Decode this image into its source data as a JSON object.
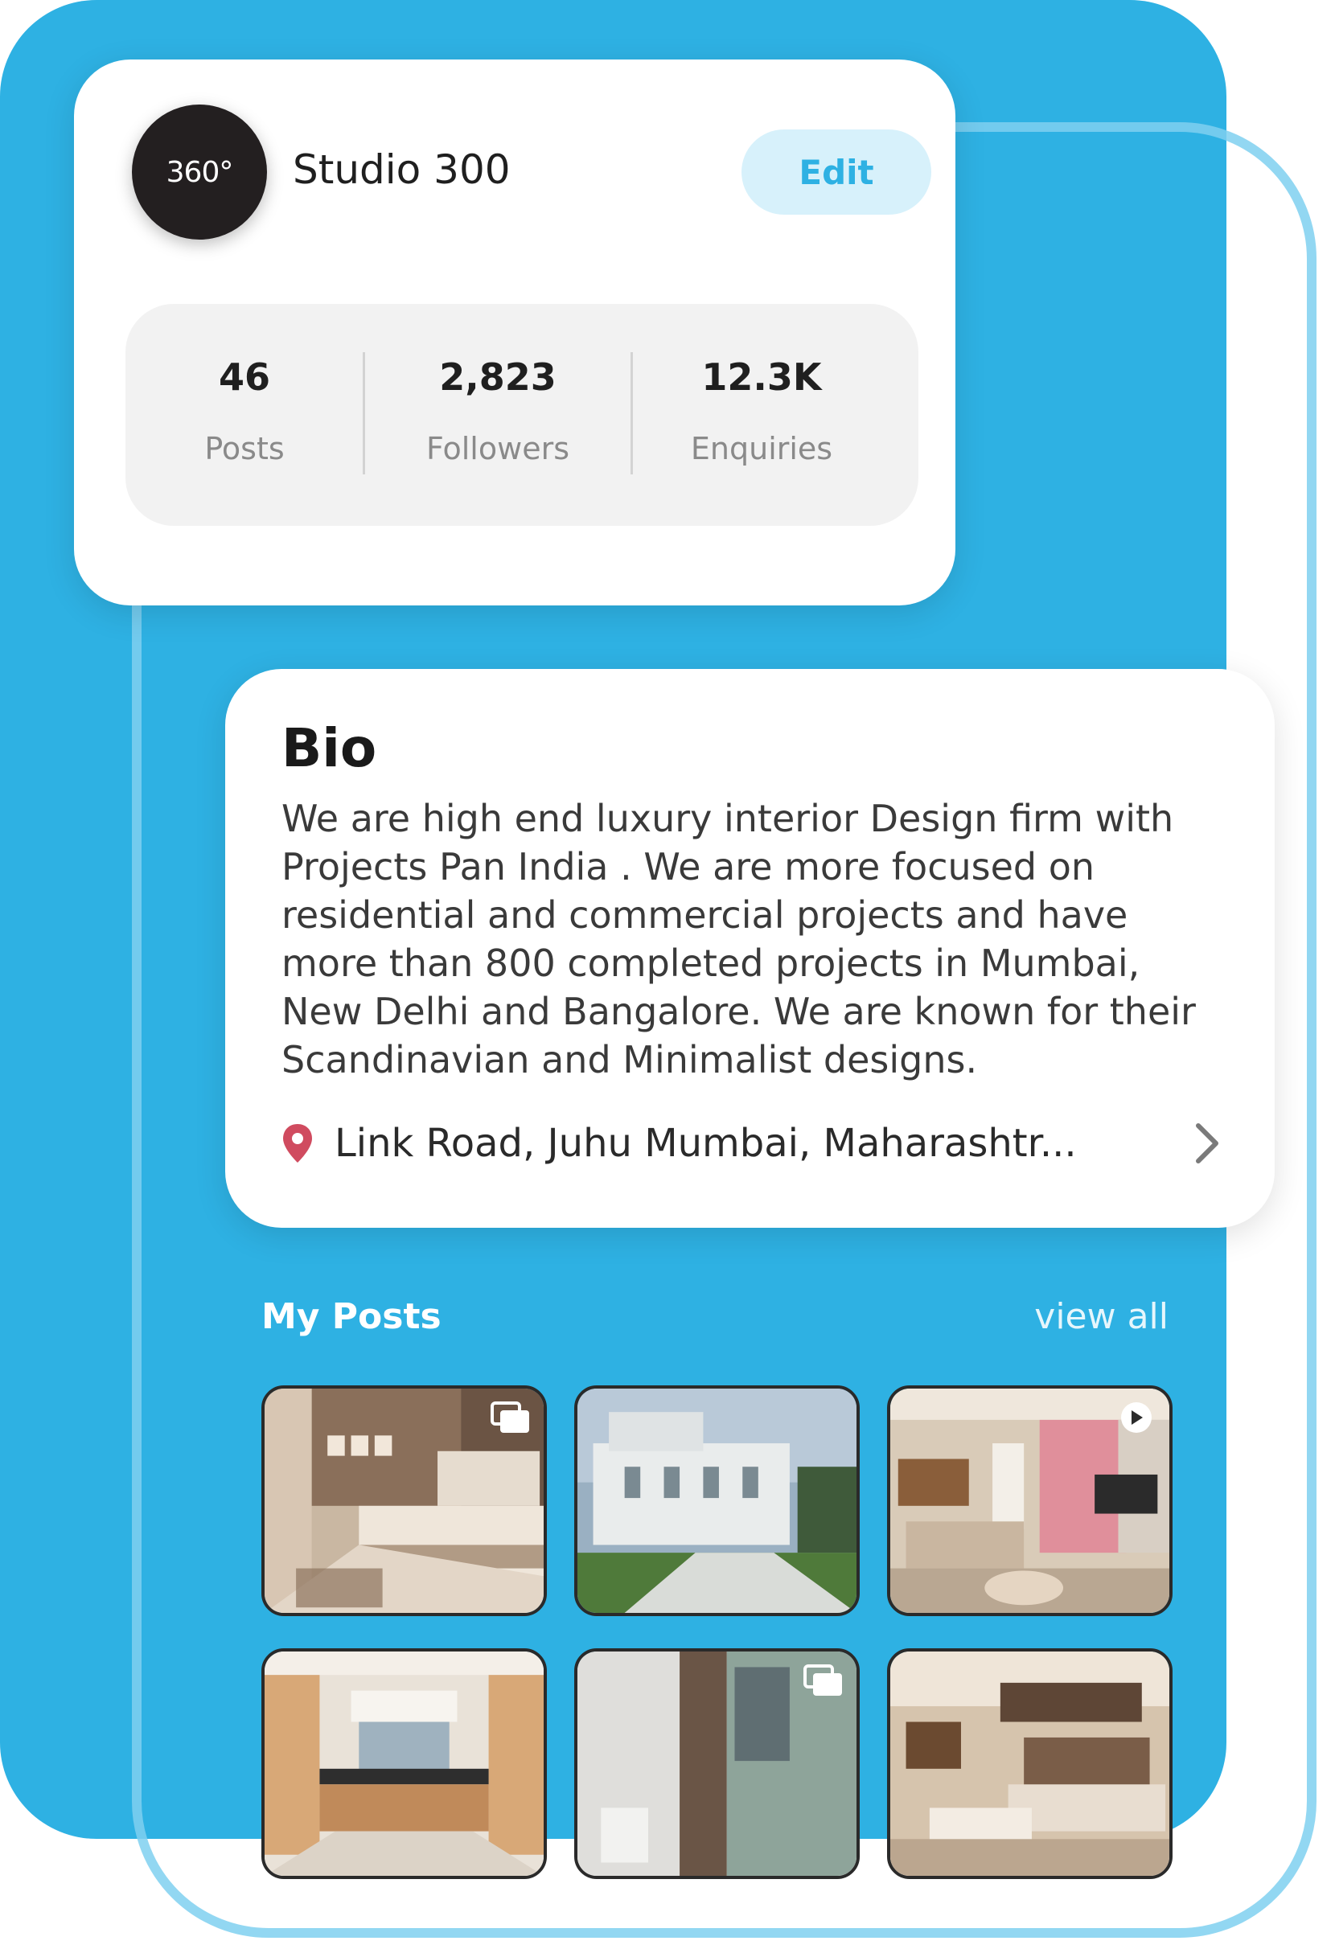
{
  "profile": {
    "avatar_text": "360°",
    "name": "Studio 300",
    "edit_label": "Edit",
    "stats": [
      {
        "value": "46",
        "label": "Posts"
      },
      {
        "value": "2,823",
        "label": "Followers"
      },
      {
        "value": "12.3K",
        "label": "Enquiries"
      }
    ]
  },
  "bio": {
    "title": "Bio",
    "text": "We are high end luxury interior Design firm with Projects Pan India . We are more focused on residential and commercial projects and have more than 800 completed projects in Mumbai, New Delhi and Bangalore. We are known for their Scandinavian and Minimalist designs.",
    "location": "Link Road, Juhu Mumbai, Maharashtr..."
  },
  "posts": {
    "title": "My Posts",
    "view_all": "view all",
    "items": [
      {
        "name": "bedroom",
        "overlay": "gallery-icon"
      },
      {
        "name": "villa-exterior",
        "overlay": ""
      },
      {
        "name": "living-room",
        "overlay": "play-icon"
      },
      {
        "name": "kitchen",
        "overlay": ""
      },
      {
        "name": "bathroom",
        "overlay": "gallery-icon"
      },
      {
        "name": "master-bedroom",
        "overlay": ""
      }
    ]
  },
  "colors": {
    "brand_blue": "#2eb1e3",
    "edit_bg": "#d7f1fb",
    "pin": "#d04b5f"
  }
}
